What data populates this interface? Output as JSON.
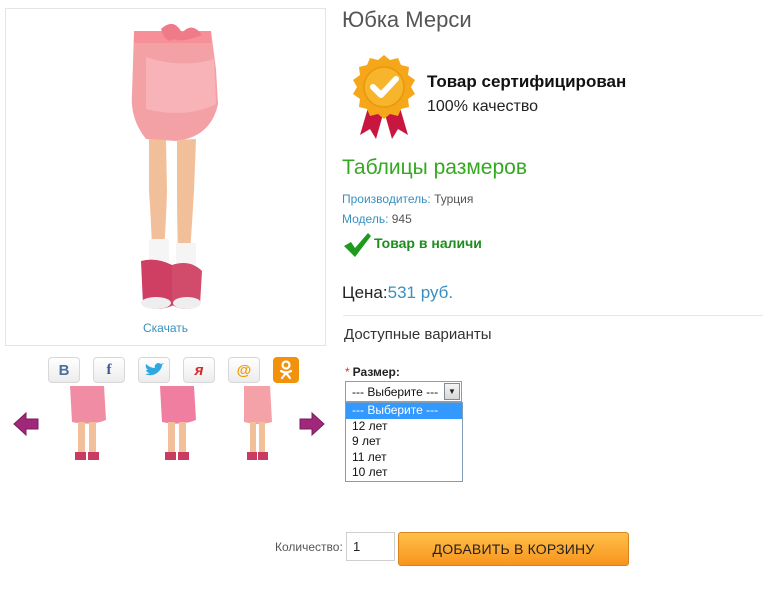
{
  "product": {
    "title": "Юбка Мерси",
    "download_label": "Скачать"
  },
  "certificate": {
    "title": "Товар сертифицирован",
    "subtitle": "100% качество"
  },
  "size_tables_link": "Таблицы размеров",
  "meta": {
    "manufacturer_label": "Производитель:",
    "manufacturer_value": "Турция",
    "model_label": "Модель:",
    "model_value": "945"
  },
  "stock_text": "Товар в наличи",
  "price": {
    "label": "Цена:",
    "amount": "531 руб."
  },
  "options": {
    "heading": "Доступные варианты",
    "size_label": "Размер:",
    "required_mark": "*",
    "selected": "--- Выберите ---",
    "items": [
      "--- Выберите ---",
      "12 лет",
      "9 лет",
      "11 лет",
      "10 лет"
    ]
  },
  "quantity": {
    "label": "Количество:",
    "value": "1"
  },
  "cart_button": "ДОБАВИТЬ В КОРЗИНУ",
  "social": [
    {
      "name": "vk",
      "glyph": "В",
      "color": "#4a6f9c"
    },
    {
      "name": "facebook",
      "glyph": "f",
      "color": "#3b5998"
    },
    {
      "name": "twitter",
      "glyph": "🐦",
      "color": "#2fa8e0"
    },
    {
      "name": "moi-krug",
      "glyph": "я",
      "color": "#d42a2a"
    },
    {
      "name": "mail",
      "glyph": "@",
      "color": "#f39800"
    },
    {
      "name": "odnoklassniki",
      "glyph": "ок",
      "color": "#ffffff"
    }
  ],
  "colors": {
    "accent_link": "#3a8fbf",
    "green": "#34a821",
    "button_orange": "#f7941d"
  }
}
